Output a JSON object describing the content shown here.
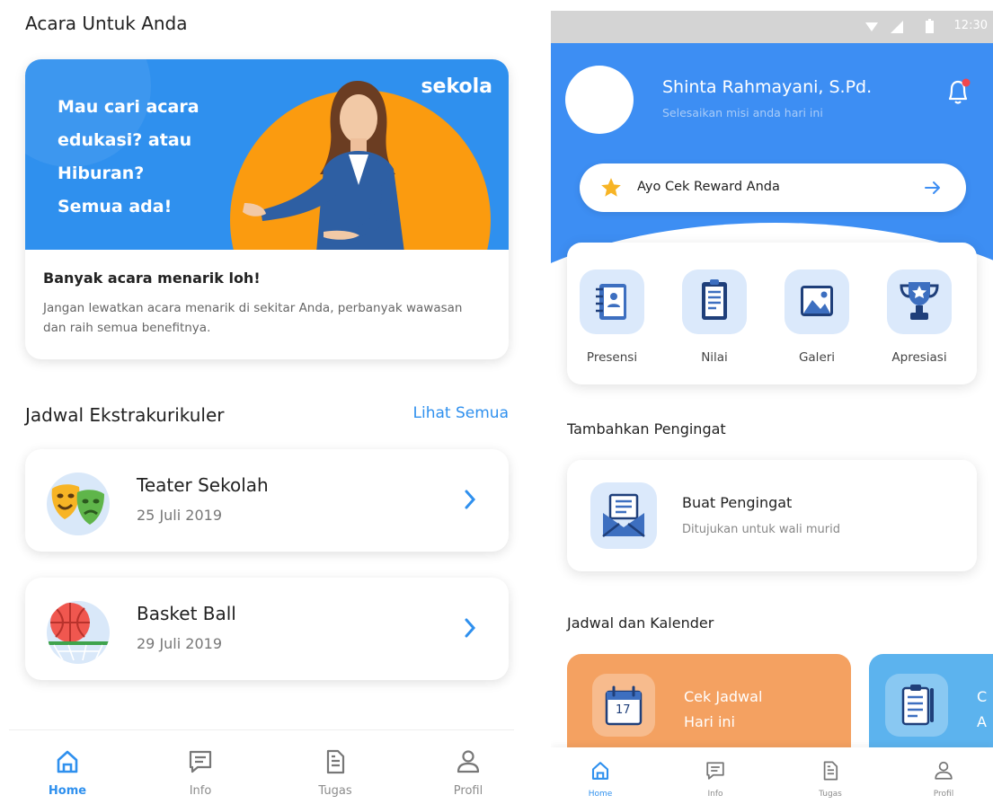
{
  "left": {
    "events_title": "Acara Untuk Anda",
    "promo": {
      "brand": "sekola",
      "headline_lines": [
        "Mau cari acara",
        "edukasi? atau",
        "Hiburan?",
        "Semua ada!"
      ],
      "title": "Banyak acara menarik loh!",
      "description": "Jangan lewatkan acara menarik di sekitar Anda, perbanyak wawasan dan raih semua benefitnya."
    },
    "schedule_title": "Jadwal Ekstrakurikuler",
    "see_all": "Lihat Semua",
    "events": [
      {
        "name": "Teater Sekolah",
        "date": "25 Juli 2019",
        "icon": "theater-masks-icon"
      },
      {
        "name": "Basket Ball",
        "date": "29 Juli 2019",
        "icon": "basketball-icon"
      }
    ],
    "nav": [
      {
        "label": "Home",
        "icon": "home-icon",
        "active": true
      },
      {
        "label": "Info",
        "icon": "message-icon",
        "active": false
      },
      {
        "label": "Tugas",
        "icon": "document-icon",
        "active": false
      },
      {
        "label": "Profil",
        "icon": "user-icon",
        "active": false
      }
    ]
  },
  "right": {
    "status_time": "12:30",
    "user": {
      "name": "Shinta Rahmayani, S.Pd.",
      "subtitle": "Selesaikan misi anda hari ini"
    },
    "reward_label": "Ayo Cek Reward Anda",
    "menu": [
      {
        "label": "Presensi",
        "icon": "attendance-book-icon"
      },
      {
        "label": "Nilai",
        "icon": "grade-sheet-icon"
      },
      {
        "label": "Galeri",
        "icon": "gallery-icon"
      },
      {
        "label": "Apresiasi",
        "icon": "trophy-icon"
      }
    ],
    "reminder_section": "Tambahkan Pengingat",
    "reminder": {
      "title": "Buat Pengingat",
      "subtitle": "Ditujukan untuk wali murid",
      "icon": "envelope-icon"
    },
    "calendar_section": "Jadwal dan Kalender",
    "schedule_cards": [
      {
        "lines": [
          "Cek Jadwal",
          "Hari ini"
        ],
        "calendar_day": "17",
        "icon": "calendar-icon",
        "color": "#f4a161"
      },
      {
        "lines": [
          "C",
          "A"
        ],
        "icon": "clipboard-icon",
        "color": "#5cb3ee"
      }
    ],
    "nav": [
      {
        "label": "Home",
        "icon": "home-icon",
        "active": true
      },
      {
        "label": "Info",
        "icon": "message-icon",
        "active": false
      },
      {
        "label": "Tugas",
        "icon": "document-icon",
        "active": false
      },
      {
        "label": "Profil",
        "icon": "user-icon",
        "active": false
      }
    ]
  },
  "colors": {
    "accent": "#2f90ee",
    "orange": "#fb9b0f",
    "nav_inactive": "#8c8c8c"
  }
}
